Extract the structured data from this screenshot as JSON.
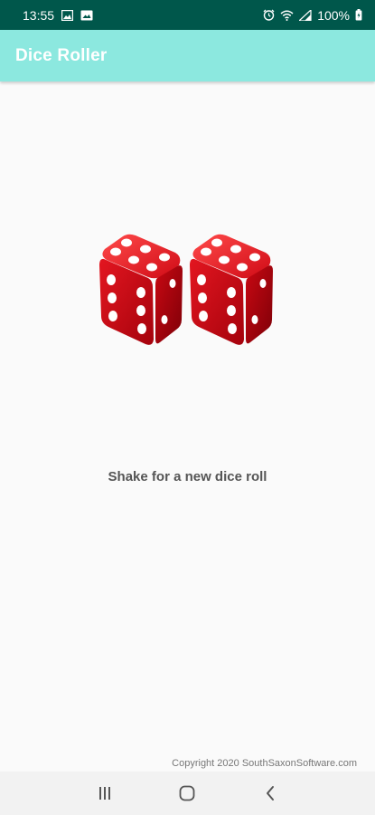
{
  "status_bar": {
    "time": "13:55",
    "battery": "100%",
    "icons": [
      "image-icon",
      "gallery-icon",
      "alarm-icon",
      "wifi-icon",
      "signal-icon",
      "battery-icon"
    ]
  },
  "app_bar": {
    "title": "Dice Roller"
  },
  "dice": {
    "values": [
      6,
      6
    ],
    "color": "#d0101b",
    "pip_color": "#ffffff"
  },
  "main": {
    "instruction": "Shake for a new dice roll",
    "copyright": "Copyright 2020 SouthSaxonSoftware.com"
  },
  "nav_bar": {
    "buttons": [
      "recent-apps-icon",
      "home-icon",
      "back-icon"
    ]
  },
  "colors": {
    "status_bar": "#00574b",
    "app_bar": "#8ce8df",
    "background": "#fafafa"
  }
}
